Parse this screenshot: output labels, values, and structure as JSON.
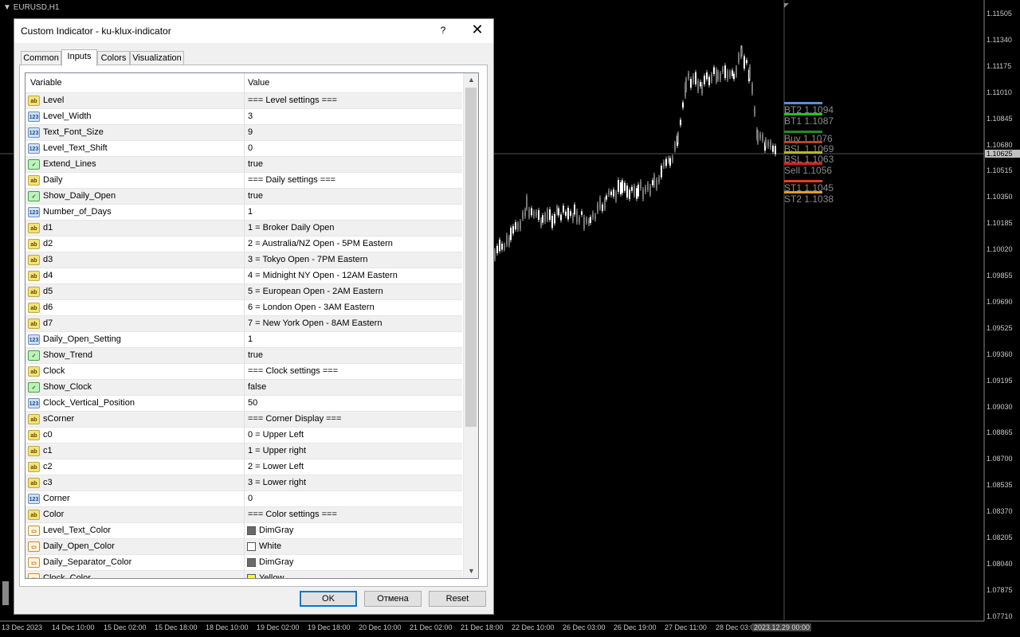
{
  "chart": {
    "symbol": "EURUSD,H1",
    "price_axis": [
      "1.11505",
      "1.11340",
      "1.11175",
      "1.11010",
      "1.10845",
      "1.10680",
      "1.10515",
      "1.10350",
      "1.10185",
      "1.10020",
      "1.09855",
      "1.09690",
      "1.09525",
      "1.09360",
      "1.09195",
      "1.09030",
      "1.08865",
      "1.08700",
      "1.08535",
      "1.08370",
      "1.08205",
      "1.08040",
      "1.07875",
      "1.07710"
    ],
    "current_price": "1.10625",
    "time_axis": [
      "13 Dec 2023",
      "14 Dec 10:00",
      "15 Dec 02:00",
      "15 Dec 18:00",
      "18 Dec 10:00",
      "19 Dec 02:00",
      "19 Dec 18:00",
      "20 Dec 10:00",
      "21 Dec 02:00",
      "21 Dec 18:00",
      "22 Dec 10:00",
      "26 Dec 03:00",
      "26 Dec 19:00",
      "27 Dec 11:00",
      "28 Dec 03:00"
    ],
    "current_time": "2023.12.29 00:00",
    "levels": [
      {
        "label": "BT2 1.1094",
        "color": "#5b8fd6"
      },
      {
        "label": "BT1 1.1087",
        "color": "#22c322"
      },
      {
        "label": "Buy 1.1076",
        "color": "#1f8f1f"
      },
      {
        "label": "BSL 1.1069",
        "color": "#b5472a"
      },
      {
        "label": "BSL 1.1063",
        "color": "#b8b822"
      },
      {
        "label": "Sell 1.1056",
        "color": "#e02020"
      },
      {
        "label": "ST1 1.1045",
        "color": "#e04020"
      },
      {
        "label": "ST2 1.1038",
        "color": "#e0a020"
      }
    ]
  },
  "dialog": {
    "title": "Custom Indicator - ku-klux-indicator",
    "help": "?",
    "close": "✕",
    "tabs": [
      {
        "label": "Common"
      },
      {
        "label": "Inputs"
      },
      {
        "label": "Colors"
      },
      {
        "label": "Visualization"
      }
    ],
    "columns": {
      "variable": "Variable",
      "value": "Value"
    },
    "rows": [
      {
        "type": "str",
        "icon": "ab",
        "name": "Level",
        "value": "=== Level settings ==="
      },
      {
        "type": "int",
        "icon": "123",
        "name": "Level_Width",
        "value": "3"
      },
      {
        "type": "int",
        "icon": "123",
        "name": "Text_Font_Size",
        "value": "9"
      },
      {
        "type": "int",
        "icon": "123",
        "name": "Level_Text_Shift",
        "value": "0"
      },
      {
        "type": "bool",
        "icon": "✓",
        "name": "Extend_Lines",
        "value": "true"
      },
      {
        "type": "str",
        "icon": "ab",
        "name": "Daily",
        "value": "=== Daily settings ==="
      },
      {
        "type": "bool",
        "icon": "✓",
        "name": "Show_Daily_Open",
        "value": "true"
      },
      {
        "type": "int",
        "icon": "123",
        "name": "Number_of_Days",
        "value": "1"
      },
      {
        "type": "str",
        "icon": "ab",
        "name": "d1",
        "value": "1 = Broker Daily Open"
      },
      {
        "type": "str",
        "icon": "ab",
        "name": "d2",
        "value": "2 = Australia/NZ Open - 5PM Eastern"
      },
      {
        "type": "str",
        "icon": "ab",
        "name": "d3",
        "value": "3 = Tokyo Open - 7PM Eastern"
      },
      {
        "type": "str",
        "icon": "ab",
        "name": "d4",
        "value": "4 = Midnight NY Open - 12AM Eastern"
      },
      {
        "type": "str",
        "icon": "ab",
        "name": "d5",
        "value": "5 = European Open - 2AM Eastern"
      },
      {
        "type": "str",
        "icon": "ab",
        "name": "d6",
        "value": "6 = London Open - 3AM Eastern"
      },
      {
        "type": "str",
        "icon": "ab",
        "name": "d7",
        "value": "7 = New York Open - 8AM Eastern"
      },
      {
        "type": "int",
        "icon": "123",
        "name": "Daily_Open_Setting",
        "value": "1"
      },
      {
        "type": "bool",
        "icon": "✓",
        "name": "Show_Trend",
        "value": "true"
      },
      {
        "type": "str",
        "icon": "ab",
        "name": "Clock",
        "value": "=== Clock settings ==="
      },
      {
        "type": "bool",
        "icon": "✓",
        "name": "Show_Clock",
        "value": "false"
      },
      {
        "type": "int",
        "icon": "123",
        "name": "Clock_Vertical_Position",
        "value": "50"
      },
      {
        "type": "str",
        "icon": "ab",
        "name": "sCorner",
        "value": "=== Corner Display ==="
      },
      {
        "type": "str",
        "icon": "ab",
        "name": "c0",
        "value": " 0 = Upper Left"
      },
      {
        "type": "str",
        "icon": "ab",
        "name": "c1",
        "value": " 1 = Upper right"
      },
      {
        "type": "str",
        "icon": "ab",
        "name": "c2",
        "value": " 2 = Lower Left"
      },
      {
        "type": "str",
        "icon": "ab",
        "name": "c3",
        "value": " 3 = Lower right"
      },
      {
        "type": "int",
        "icon": "123",
        "name": "Corner",
        "value": "0"
      },
      {
        "type": "str",
        "icon": "ab",
        "name": "Color",
        "value": "=== Color settings ==="
      },
      {
        "type": "color",
        "icon": "▭",
        "name": "Level_Text_Color",
        "value": "DimGray",
        "swatch": "#696969"
      },
      {
        "type": "color",
        "icon": "▭",
        "name": "Daily_Open_Color",
        "value": "White",
        "swatch": "#ffffff"
      },
      {
        "type": "color",
        "icon": "▭",
        "name": "Daily_Separator_Color",
        "value": "DimGray",
        "swatch": "#696969"
      },
      {
        "type": "color",
        "icon": "▭",
        "name": "Clock_Color",
        "value": "Yellow",
        "swatch": "#ffff00"
      }
    ],
    "buttons": {
      "ok": "OK",
      "cancel": "Отмена",
      "reset": "Reset"
    }
  }
}
